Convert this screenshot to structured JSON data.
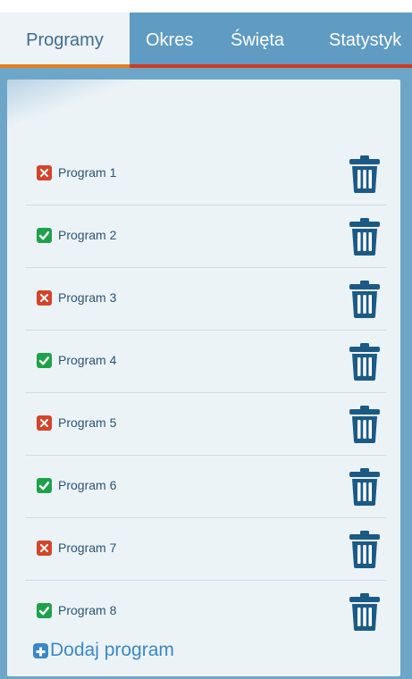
{
  "tabs": [
    {
      "label": "Programy"
    },
    {
      "label": "Okres"
    },
    {
      "label": "Święta"
    },
    {
      "label": "Statystyk"
    }
  ],
  "colors": {
    "tab_bar": "#5f9bc2",
    "active_tab_bg": "#edf3f7",
    "accent_red": "#d13a1e",
    "accent_orange": "#e57b1f",
    "check_on": "#1fa14a",
    "check_off": "#d4442a",
    "trash": "#1c5a86",
    "link": "#3b88c7"
  },
  "programs": [
    {
      "label": "Program 1",
      "enabled": false
    },
    {
      "label": "Program 2",
      "enabled": true
    },
    {
      "label": "Program 3",
      "enabled": false
    },
    {
      "label": "Program 4",
      "enabled": true
    },
    {
      "label": "Program 5",
      "enabled": false
    },
    {
      "label": "Program 6",
      "enabled": true
    },
    {
      "label": "Program 7",
      "enabled": false
    },
    {
      "label": "Program 8",
      "enabled": true
    }
  ],
  "add_program": {
    "label": "Dodaj program",
    "icon": "plus-square-icon"
  },
  "row_icons": {
    "delete": "trash-icon",
    "on": "check-icon",
    "off": "x-icon"
  }
}
